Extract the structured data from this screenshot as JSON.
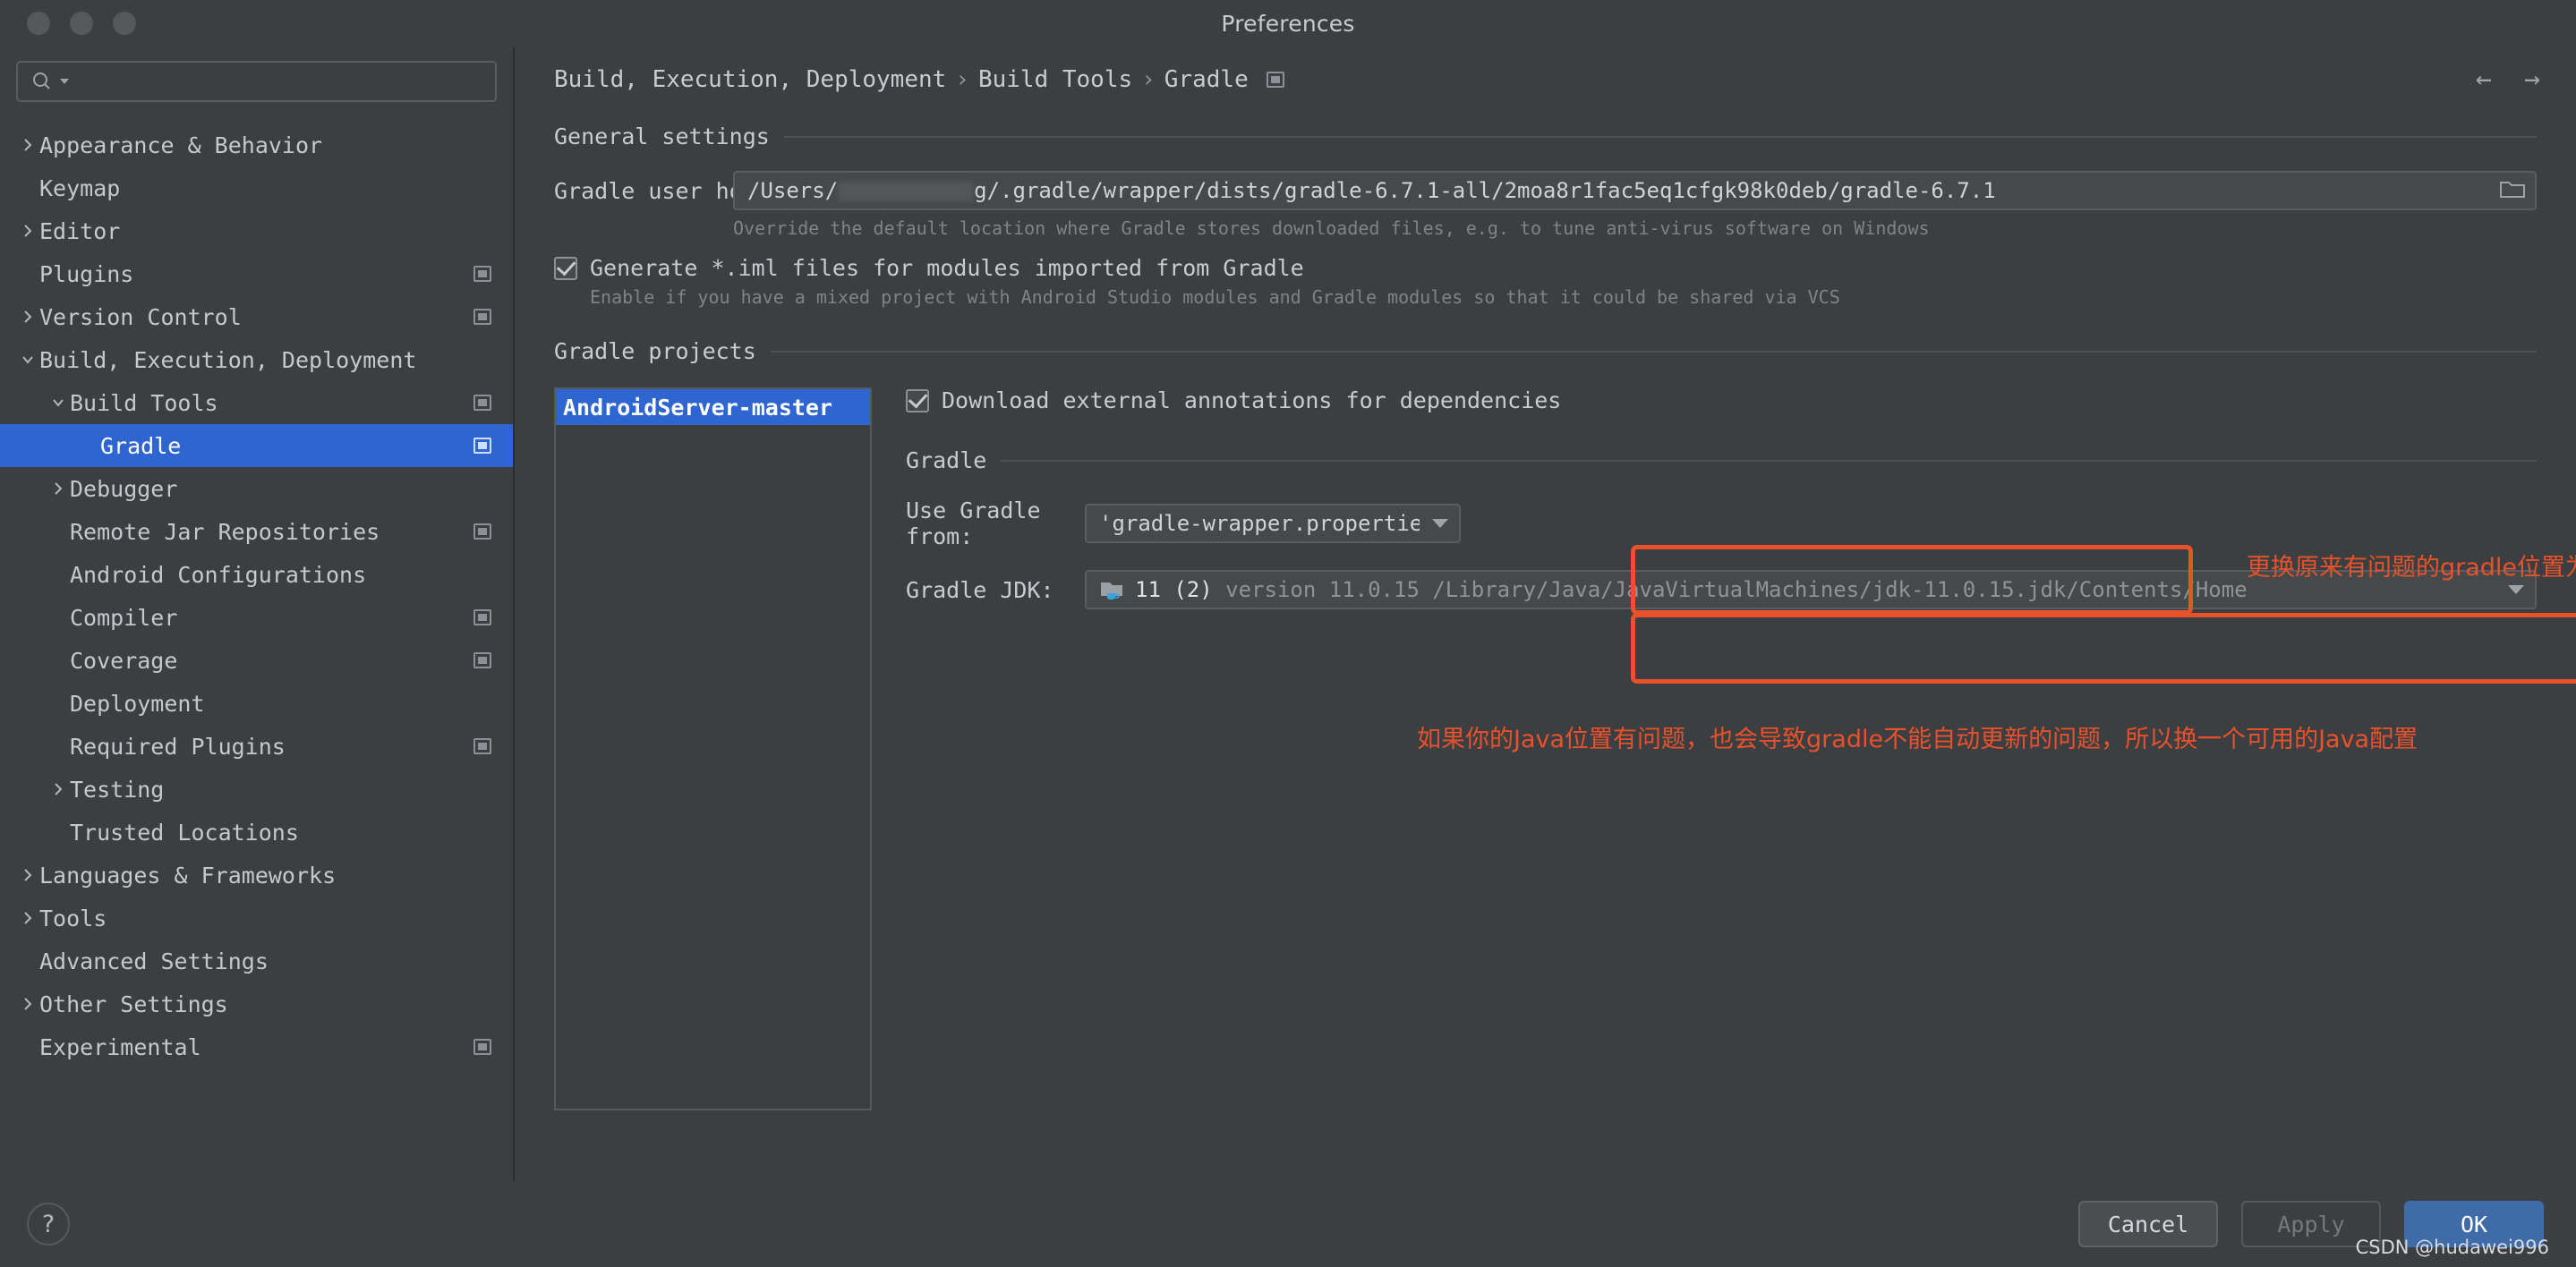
{
  "window": {
    "title": "Preferences",
    "traffic_lights": [
      "close",
      "minimize",
      "zoom"
    ]
  },
  "sidebar": {
    "search": {
      "placeholder": "",
      "value": "",
      "icon": "search-icon"
    },
    "items": [
      {
        "label": "Appearance & Behavior",
        "indent": 0,
        "arrow": "collapsed",
        "badge": false,
        "selected": false
      },
      {
        "label": "Keymap",
        "indent": 0,
        "arrow": "none",
        "badge": false,
        "selected": false
      },
      {
        "label": "Editor",
        "indent": 0,
        "arrow": "collapsed",
        "badge": false,
        "selected": false
      },
      {
        "label": "Plugins",
        "indent": 0,
        "arrow": "none",
        "badge": true,
        "selected": false
      },
      {
        "label": "Version Control",
        "indent": 0,
        "arrow": "collapsed",
        "badge": true,
        "selected": false
      },
      {
        "label": "Build, Execution, Deployment",
        "indent": 0,
        "arrow": "expanded",
        "badge": false,
        "selected": false
      },
      {
        "label": "Build Tools",
        "indent": 1,
        "arrow": "expanded",
        "badge": true,
        "selected": false
      },
      {
        "label": "Gradle",
        "indent": 2,
        "arrow": "none",
        "badge": true,
        "selected": true
      },
      {
        "label": "Debugger",
        "indent": 1,
        "arrow": "collapsed",
        "badge": false,
        "selected": false
      },
      {
        "label": "Remote Jar Repositories",
        "indent": 1,
        "arrow": "none",
        "badge": true,
        "selected": false
      },
      {
        "label": "Android Configurations",
        "indent": 1,
        "arrow": "none",
        "badge": false,
        "selected": false
      },
      {
        "label": "Compiler",
        "indent": 1,
        "arrow": "none",
        "badge": true,
        "selected": false
      },
      {
        "label": "Coverage",
        "indent": 1,
        "arrow": "none",
        "badge": true,
        "selected": false
      },
      {
        "label": "Deployment",
        "indent": 1,
        "arrow": "none",
        "badge": false,
        "selected": false
      },
      {
        "label": "Required Plugins",
        "indent": 1,
        "arrow": "none",
        "badge": true,
        "selected": false
      },
      {
        "label": "Testing",
        "indent": 1,
        "arrow": "collapsed",
        "badge": false,
        "selected": false
      },
      {
        "label": "Trusted Locations",
        "indent": 1,
        "arrow": "none",
        "badge": false,
        "selected": false
      },
      {
        "label": "Languages & Frameworks",
        "indent": 0,
        "arrow": "collapsed",
        "badge": false,
        "selected": false
      },
      {
        "label": "Tools",
        "indent": 0,
        "arrow": "collapsed",
        "badge": false,
        "selected": false
      },
      {
        "label": "Advanced Settings",
        "indent": 0,
        "arrow": "none",
        "badge": false,
        "selected": false
      },
      {
        "label": "Other Settings",
        "indent": 0,
        "arrow": "collapsed",
        "badge": false,
        "selected": false
      },
      {
        "label": "Experimental",
        "indent": 0,
        "arrow": "none",
        "badge": true,
        "selected": false
      }
    ]
  },
  "breadcrumb": {
    "parts": [
      "Build, Execution, Deployment",
      "Build Tools",
      "Gradle"
    ],
    "separator": "›",
    "back_icon": "←",
    "forward_icon": "→"
  },
  "general_settings": {
    "title": "General settings",
    "gradle_user_home": {
      "label": "Gradle user home:",
      "value_prefix": "/Users/",
      "value_redacted": true,
      "value_suffix": "g/.gradle/wrapper/dists/gradle-6.7.1-all/2moa8r1fac5eq1cfgk98k0deb/gradle-6.7.1",
      "hint": "Override the default location where Gradle stores downloaded files, e.g. to tune anti-virus software on Windows",
      "browse_icon": "folder-icon"
    },
    "generate_iml": {
      "label": "Generate *.iml files for modules imported from Gradle",
      "checked": true,
      "hint": "Enable if you have a mixed project with Android Studio modules and Gradle modules so that it could be shared via VCS"
    }
  },
  "gradle_projects": {
    "title": "Gradle projects",
    "list": [
      {
        "label": "AndroidServer-master",
        "selected": true
      }
    ],
    "download_annotations": {
      "label": "Download external annotations for dependencies",
      "checked": true
    }
  },
  "gradle_section": {
    "title": "Gradle",
    "use_gradle_from": {
      "label": "Use Gradle from:",
      "value": "'gradle-wrapper.properties' file",
      "options": [
        "'gradle-wrapper.properties' file"
      ]
    },
    "gradle_jdk": {
      "label": "Gradle JDK:",
      "icon": "jdk-folder-icon",
      "value_main": "11 (2)",
      "value_detail": "version 11.0.15 /Library/Java/JavaVirtualMachines/jdk-11.0.15.jdk/Contents/Home"
    }
  },
  "annotations": {
    "color": "#e8512a",
    "note_gradle": "更换原来有问题的gradle位置为截图这种默认配置",
    "note_java": "如果你的Java位置有问题，也会导致gradle不能自动更新的问题，所以换一个可用的Java配置"
  },
  "footer": {
    "help_label": "?",
    "cancel_label": "Cancel",
    "apply_label": "Apply",
    "ok_label": "OK",
    "watermark": "CSDN @hudawei996"
  }
}
